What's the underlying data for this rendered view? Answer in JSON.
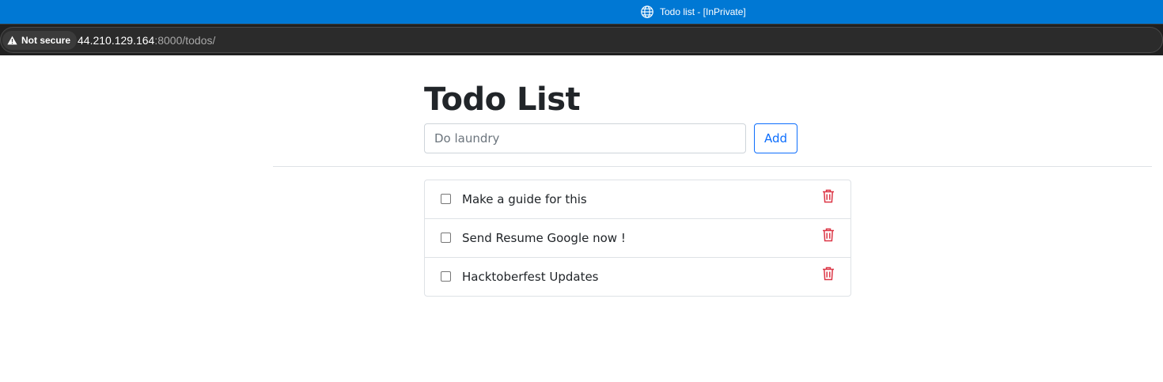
{
  "browser": {
    "window_title": "Todo list - [InPrivate]",
    "security_label": "Not secure",
    "url_host": "44.210.129.164",
    "url_rest": ":8000/todos/",
    "titlebar_color": "#0078d4"
  },
  "page": {
    "heading": "Todo List",
    "input": {
      "placeholder": "Do laundry",
      "value": ""
    },
    "add_button_label": "Add",
    "todos": [
      {
        "text": "Make a guide for this",
        "checked": false
      },
      {
        "text": "Send Resume Google now !",
        "checked": false
      },
      {
        "text": "Hacktoberfest Updates",
        "checked": false
      }
    ],
    "icons": {
      "delete": "trash-icon",
      "title": "globe-icon",
      "security": "warning-icon"
    },
    "colors": {
      "primary": "#0d6efd",
      "danger": "#dc3545",
      "text": "#212529"
    }
  }
}
